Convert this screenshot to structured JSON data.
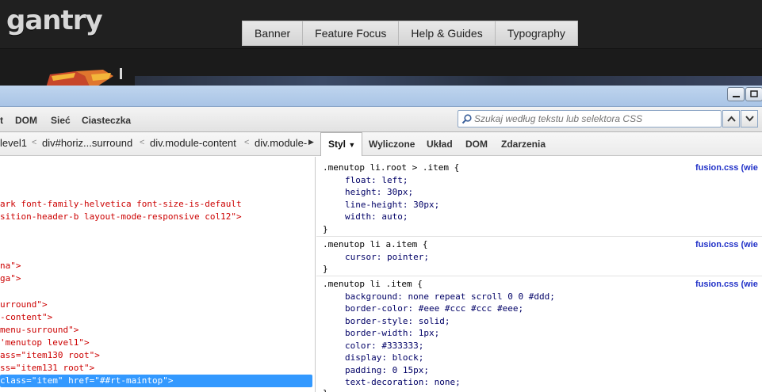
{
  "site": {
    "logo": "gantry",
    "nav": [
      "Banner",
      "Feature Focus",
      "Help & Guides",
      "Typography"
    ]
  },
  "firebug": {
    "tabs": [
      "t",
      "DOM",
      "Sieć",
      "Ciasteczka"
    ],
    "search_placeholder": "Szukaj według tekstu lub selektora CSS",
    "breadcrumbs": [
      "level1",
      "div#horiz...surround",
      "div.module-content",
      "div.module-"
    ],
    "side_tabs": {
      "active": "Styl",
      "items": [
        "Wyliczone",
        "Układ",
        "DOM",
        "Zdarzenia"
      ]
    },
    "html_lines": [
      {
        "text": "ark font-family-helvetica font-size-is-default",
        "kind": "attr"
      },
      {
        "text": "sition-header-b layout-mode-responsive col12\">",
        "kind": "attr"
      },
      {
        "text": "na\">",
        "kind": "attr"
      },
      {
        "text": "ga\">",
        "kind": "attr"
      },
      {
        "text": "urround\">",
        "kind": "attr"
      },
      {
        "text": "-content\">",
        "kind": "attr"
      },
      {
        "text": "menu-surround\">",
        "kind": "attr"
      },
      {
        "text": "'menutop level1\">",
        "kind": "attr"
      },
      {
        "text": "ass=\"item130 root\">",
        "kind": "attr"
      },
      {
        "text": "ss=\"item131 root\">",
        "kind": "attr"
      },
      {
        "text": "class=\"item\" href=\"##rt-maintop\">",
        "kind": "selected"
      }
    ],
    "css_rules": [
      {
        "selector": ".menutop li.root > .item {",
        "source": "fusion.css (wie",
        "props": [
          "float: left;",
          "height: 30px;",
          "line-height: 30px;",
          "width: auto;"
        ]
      },
      {
        "selector": ".menutop li a.item {",
        "source": "fusion.css (wie",
        "props": [
          "cursor: pointer;"
        ]
      },
      {
        "selector": ".menutop li .item {",
        "source": "fusion.css (wie",
        "props": [
          "background: none repeat scroll 0 0 #ddd;",
          "border-color: #eee #ccc #ccc #eee;",
          "border-style: solid;",
          "border-width: 1px;",
          "color: #333333;",
          "display: block;",
          "padding: 0 15px;",
          "text-decoration: none;"
        ]
      }
    ],
    "close_brace": "}"
  }
}
